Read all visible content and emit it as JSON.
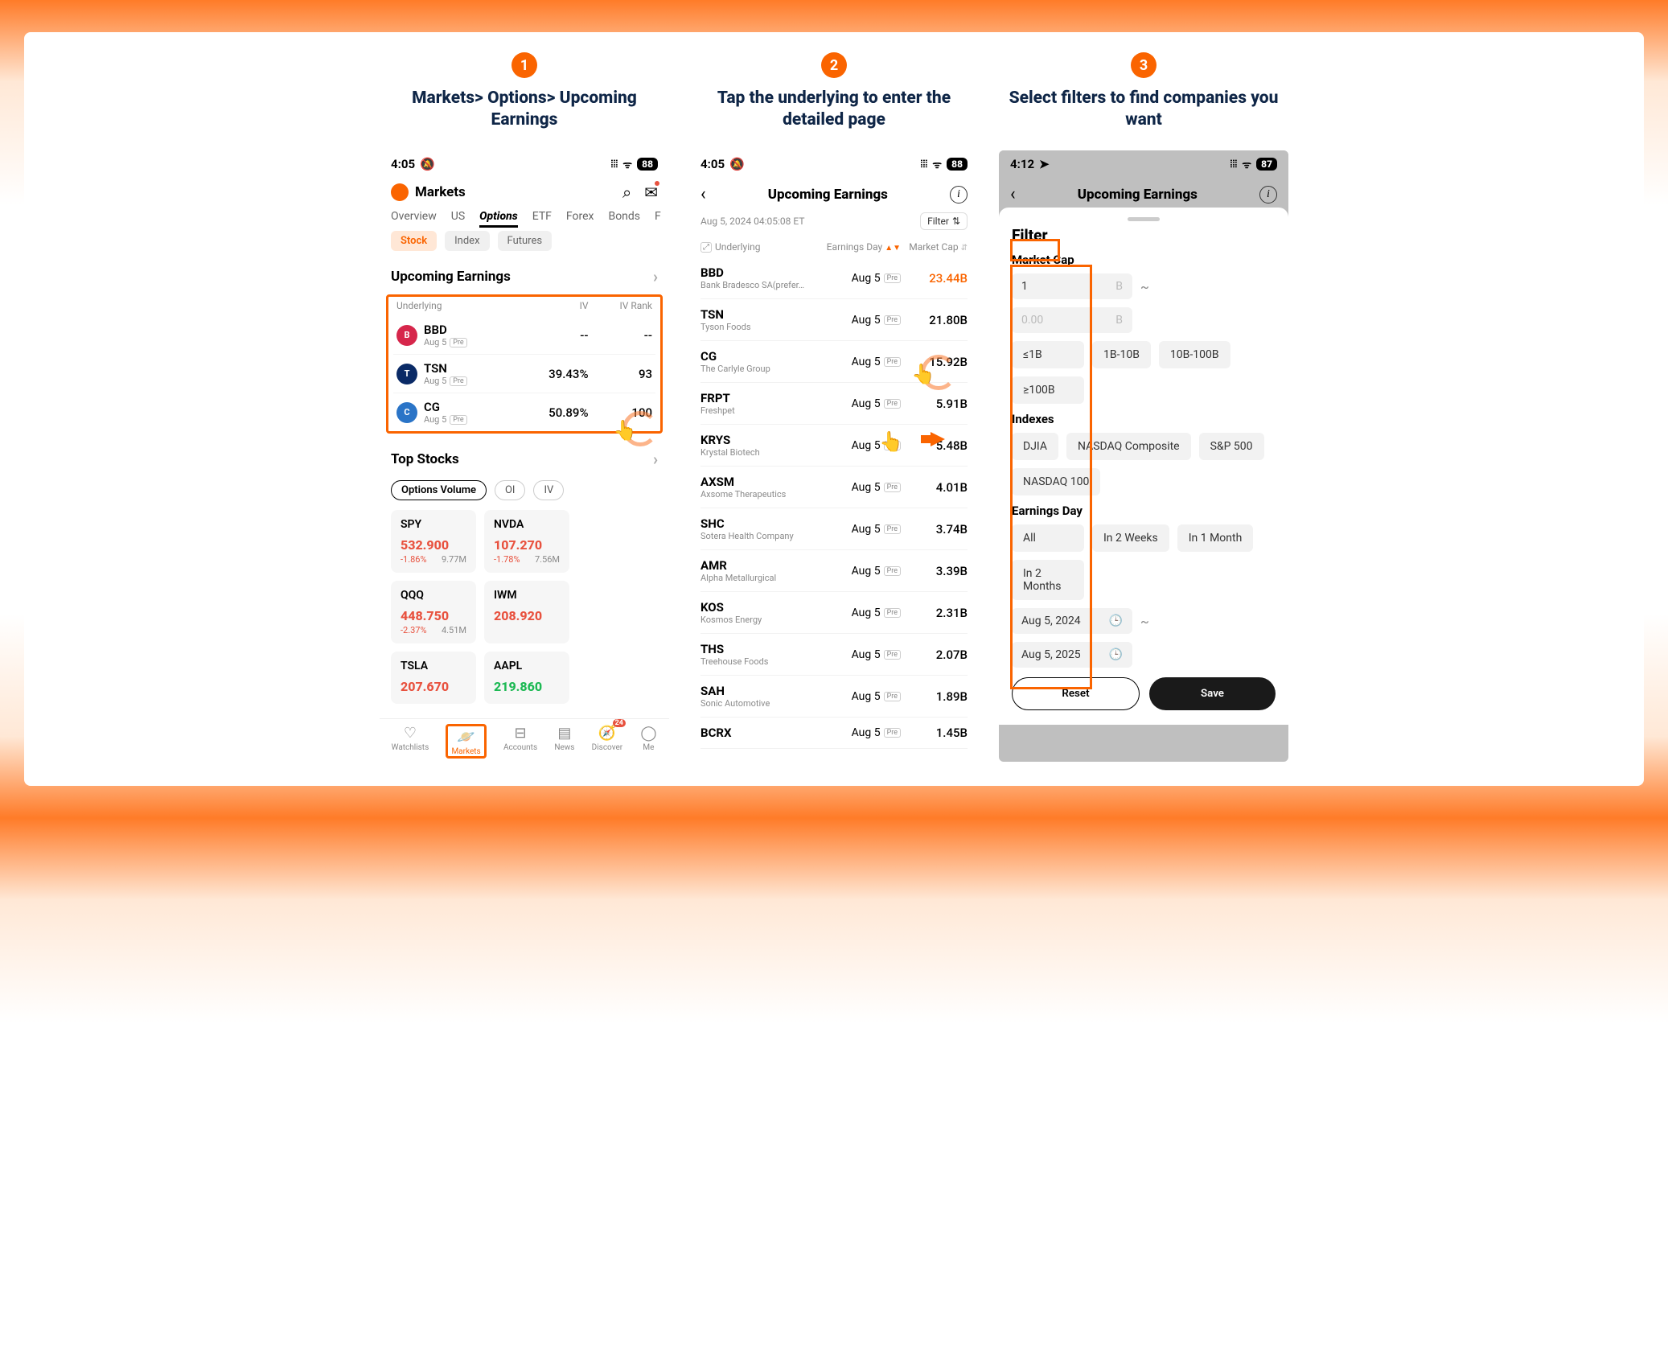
{
  "steps": [
    {
      "num": "1",
      "title": "Markets> Options> Upcoming Earnings"
    },
    {
      "num": "2",
      "title": "Tap the underlying to enter the detailed page"
    },
    {
      "num": "3",
      "title": "Select filters to find companies you want"
    }
  ],
  "screen1": {
    "time": "4:05",
    "battery": "88",
    "header_title": "Markets",
    "tabs": [
      "Overview",
      "US",
      "Options",
      "ETF",
      "Forex",
      "Bonds",
      "F"
    ],
    "active_tab": "Options",
    "subtabs": [
      "Stock",
      "Index",
      "Futures"
    ],
    "active_subtab": "Stock",
    "section_upcoming": "Upcoming Earnings",
    "ue_cols": [
      "Underlying",
      "IV",
      "IV Rank"
    ],
    "ue_rows": [
      {
        "sym": "BBD",
        "date": "Aug 5",
        "iv": "--",
        "rank": "--",
        "color": "#d6264b"
      },
      {
        "sym": "TSN",
        "date": "Aug 5",
        "iv": "39.43%",
        "rank": "93",
        "color": "#0a2a66"
      },
      {
        "sym": "CG",
        "date": "Aug 5",
        "iv": "50.89%",
        "rank": "100",
        "color": "#2a74c7"
      }
    ],
    "section_top": "Top Stocks",
    "top_pills": [
      "Options Volume",
      "OI",
      "IV"
    ],
    "active_pill": "Options Volume",
    "top_stocks": [
      {
        "sym": "SPY",
        "price": "532.900",
        "chg": "-1.86%",
        "vol": "9.77M",
        "dir": "down"
      },
      {
        "sym": "NVDA",
        "price": "107.270",
        "chg": "-1.78%",
        "vol": "7.56M",
        "dir": "down"
      },
      {
        "sym": "QQQ",
        "price": "448.750",
        "chg": "-2.37%",
        "vol": "4.51M",
        "dir": "down"
      },
      {
        "sym": "IWM",
        "price": "208.920",
        "chg": "",
        "vol": "",
        "dir": "down"
      },
      {
        "sym": "TSLA",
        "price": "207.670",
        "chg": "",
        "vol": "",
        "dir": "down"
      },
      {
        "sym": "AAPL",
        "price": "219.860",
        "chg": "",
        "vol": "",
        "dir": "up"
      }
    ],
    "nav": [
      {
        "label": "Watchlists",
        "icon": "♡"
      },
      {
        "label": "Markets",
        "icon": "🪐",
        "active": true
      },
      {
        "label": "Accounts",
        "icon": "⊟"
      },
      {
        "label": "News",
        "icon": "▤"
      },
      {
        "label": "Discover",
        "icon": "🧭",
        "badge": "24"
      },
      {
        "label": "Me",
        "icon": "◯"
      }
    ]
  },
  "screen2": {
    "time": "4:05",
    "battery": "88",
    "title": "Upcoming Earnings",
    "timestamp": "Aug 5, 2024 04:05:08 ET",
    "filter_label": "Filter",
    "cols": [
      "Underlying",
      "Earnings Day",
      "Market Cap"
    ],
    "rows": [
      {
        "sym": "BBD",
        "name": "Bank Bradesco SA(prefer…",
        "day": "Aug 5",
        "cap": "23.44B",
        "hl": true
      },
      {
        "sym": "TSN",
        "name": "Tyson Foods",
        "day": "Aug 5",
        "cap": "21.80B"
      },
      {
        "sym": "CG",
        "name": "The Carlyle Group",
        "day": "Aug 5",
        "cap": "15.92B"
      },
      {
        "sym": "FRPT",
        "name": "Freshpet",
        "day": "Aug 5",
        "cap": "5.91B"
      },
      {
        "sym": "KRYS",
        "name": "Krystal Biotech",
        "day": "Aug 5",
        "cap": "5.48B"
      },
      {
        "sym": "AXSM",
        "name": "Axsome Therapeutics",
        "day": "Aug 5",
        "cap": "4.01B"
      },
      {
        "sym": "SHC",
        "name": "Sotera Health Company",
        "day": "Aug 5",
        "cap": "3.74B"
      },
      {
        "sym": "AMR",
        "name": "Alpha Metallurgical",
        "day": "Aug 5",
        "cap": "3.39B"
      },
      {
        "sym": "KOS",
        "name": "Kosmos Energy",
        "day": "Aug 5",
        "cap": "2.31B"
      },
      {
        "sym": "THS",
        "name": "Treehouse Foods",
        "day": "Aug 5",
        "cap": "2.07B"
      },
      {
        "sym": "SAH",
        "name": "Sonic Automotive",
        "day": "Aug 5",
        "cap": "1.89B"
      },
      {
        "sym": "BCRX",
        "name": "",
        "day": "Aug 5",
        "cap": "1.45B"
      }
    ],
    "pre_label": "Pre"
  },
  "screen3": {
    "time": "4:12",
    "battery": "87",
    "title": "Upcoming Earnings",
    "filter_heading": "Filter",
    "mc_label": "Market Cap",
    "mc_from": "1",
    "mc_to": "0.00",
    "mc_unit": "B",
    "mc_chips": [
      "≤1B",
      "1B-10B",
      "10B-100B",
      "≥100B"
    ],
    "idx_label": "Indexes",
    "idx_chips": [
      "DJIA",
      "NASDAQ Composite",
      "S&P 500",
      "NASDAQ 100"
    ],
    "ed_label": "Earnings Day",
    "ed_chips": [
      "All",
      "In 2 Weeks",
      "In 1 Month",
      "In 2 Months"
    ],
    "ed_from": "Aug 5, 2024",
    "ed_to": "Aug 5, 2025",
    "reset": "Reset",
    "save": "Save"
  }
}
